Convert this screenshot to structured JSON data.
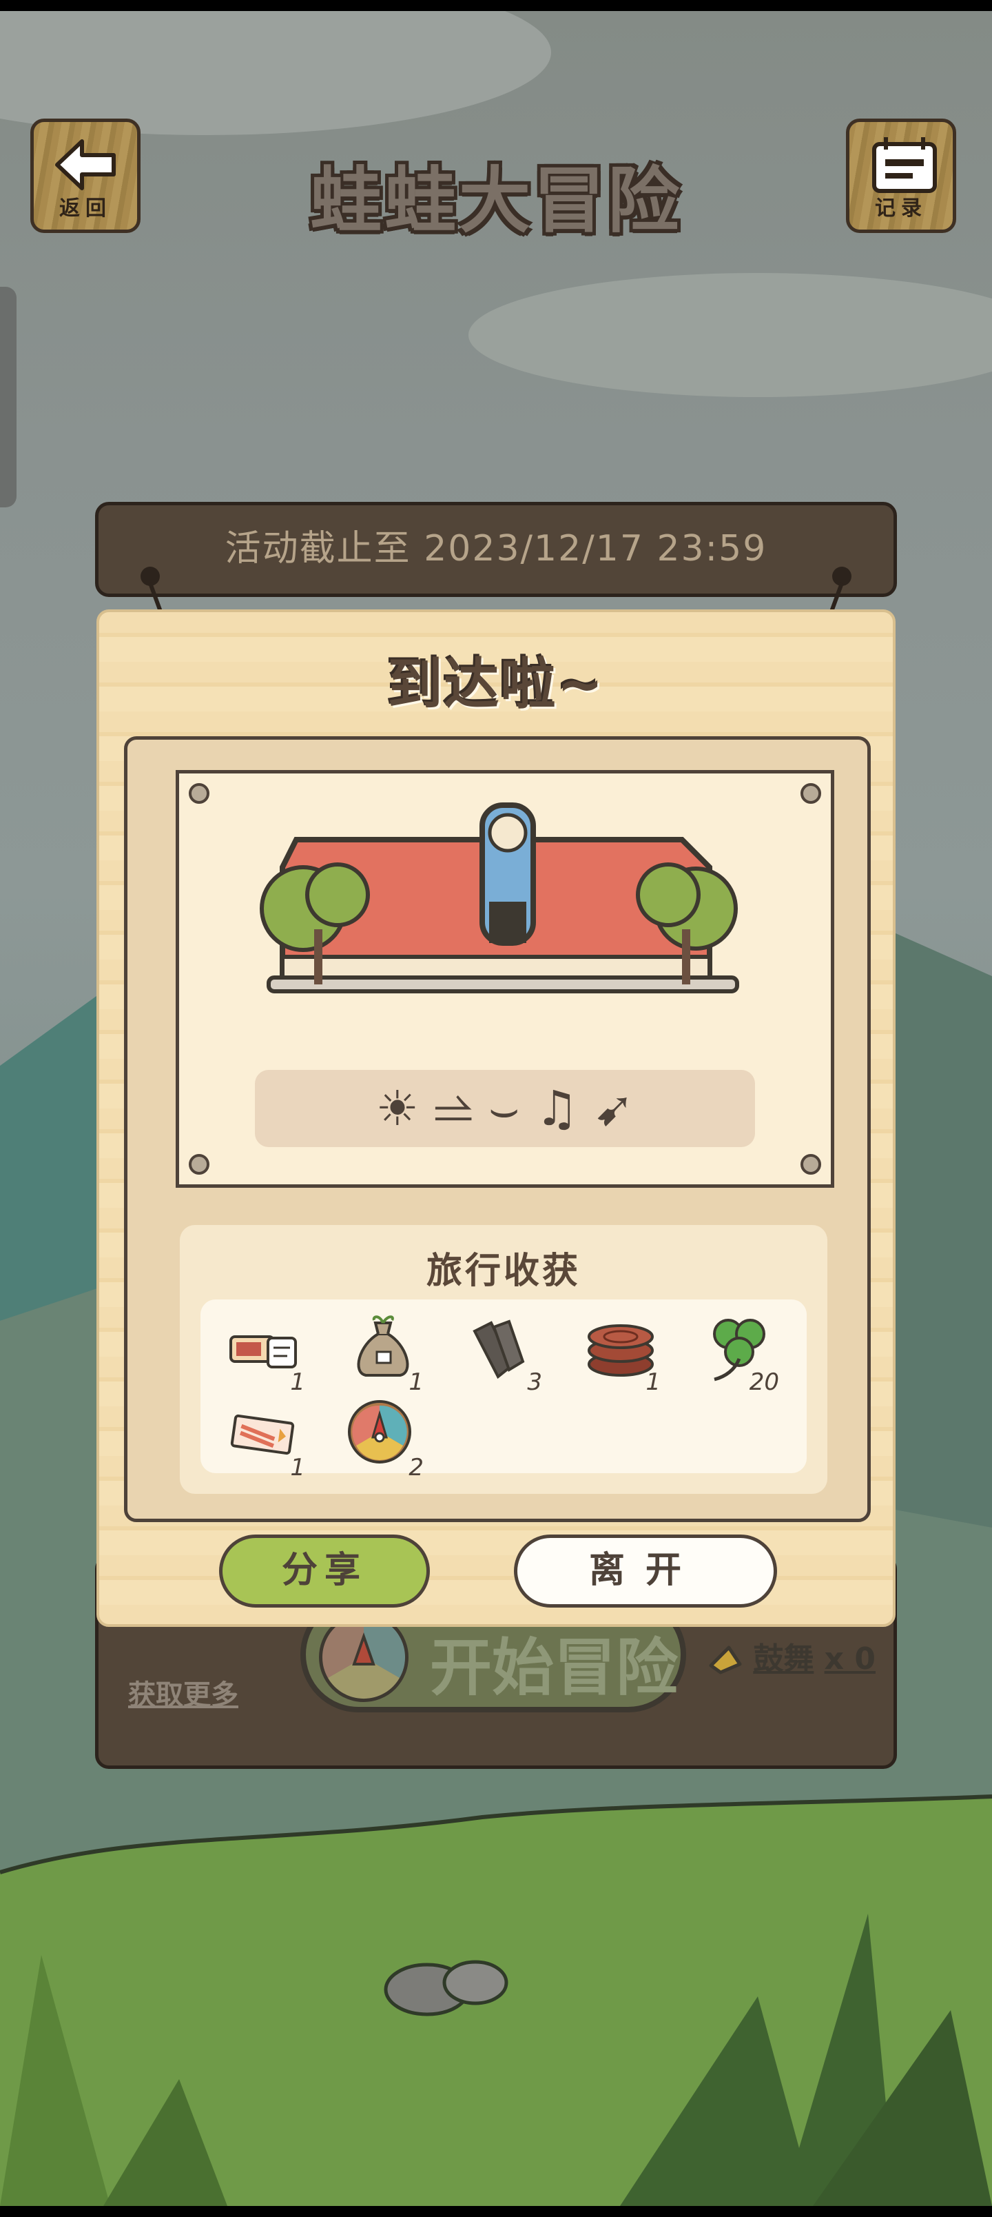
{
  "header": {
    "back_label": "返回",
    "title": "蛙蛙大冒险",
    "records_label": "记录"
  },
  "event": {
    "deadline_text": "活动截止至 2023/12/17 23:59"
  },
  "dialog": {
    "title": "到达啦~",
    "emoji_text": "☀ ⥬ ⌣ ♫ ➹",
    "loot_title": "旅行收获",
    "items": [
      {
        "icon": "ticket-icon",
        "count": "1"
      },
      {
        "icon": "seed-bag-icon",
        "count": "1"
      },
      {
        "icon": "charcoal-icon",
        "count": "3"
      },
      {
        "icon": "wood-log-icon",
        "count": "1"
      },
      {
        "icon": "clover-icon",
        "count": "20"
      },
      {
        "icon": "postcard-icon",
        "count": "1"
      },
      {
        "icon": "lucky-wheel-icon",
        "count": "2"
      }
    ],
    "share_label": "分享",
    "leave_label": "离开"
  },
  "bottom": {
    "get_more_label": "获取更多",
    "start_label": "开始冒险",
    "cheer_label": "鼓舞",
    "cheer_count": "x 0"
  },
  "colors": {
    "share_green": "#a8c455",
    "dialog_wood": "#f3ddb0",
    "panel_brown": "#524538"
  }
}
